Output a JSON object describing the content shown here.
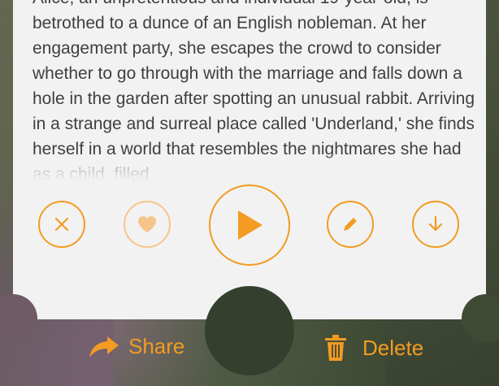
{
  "story": {
    "text": "Alice, an unpretentious and individual 19-year-old, is betrothed to a dunce of an English nobleman. At her engagement party, she escapes the crowd to consider whether to go through with the marriage and falls down a hole in the garden after spotting an unusual rabbit. Arriving in a strange and surreal place called 'Underland,' she finds herself in a world that resembles the nightmares she had as a child, filled"
  },
  "controls": {
    "close_icon": "close-icon",
    "like_icon": "heart-icon",
    "play_icon": "play-icon",
    "edit_icon": "pencil-icon",
    "download_icon": "download-icon",
    "accent_color": "#F39B22"
  },
  "bottom_bar": {
    "share_label": "Share",
    "delete_label": "Delete",
    "share_icon": "share-arrow-icon",
    "delete_icon": "trash-icon"
  }
}
